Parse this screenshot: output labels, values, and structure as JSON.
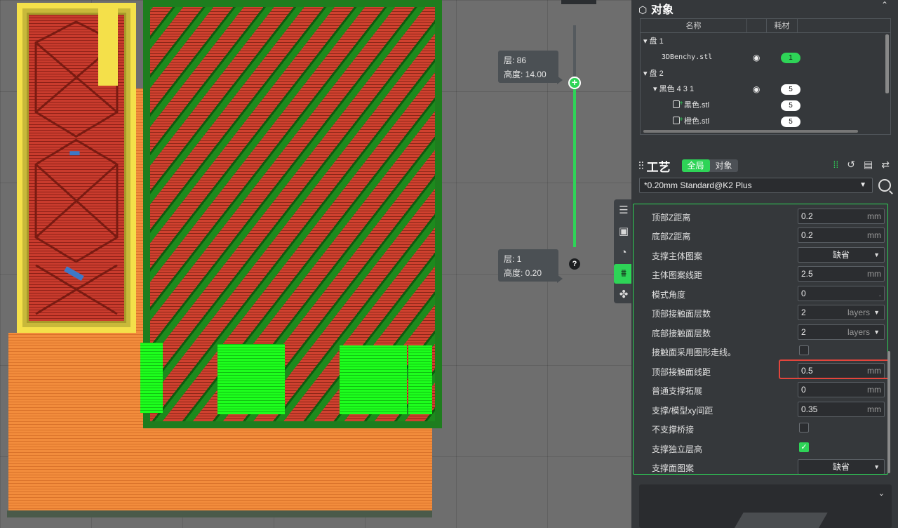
{
  "viewport": {
    "layer_top": {
      "layer_label": "层: 86",
      "height_label": "高度: 14.00"
    },
    "layer_bottom": {
      "layer_label": "层: 1",
      "height_label": "高度: 0.20"
    },
    "slider_help": "?"
  },
  "objects": {
    "title": "对象",
    "columns": {
      "name": "名称",
      "material": "耗材"
    },
    "rows": [
      {
        "name": "▾ 盘 1",
        "indent": 0
      },
      {
        "name": "3DBenchy.stl",
        "visible_icon": "eye-icon",
        "material": "1",
        "material_color": "#2ed457"
      },
      {
        "name": "▾ 盘 2",
        "indent": 0
      },
      {
        "name": "▾ 黑色 4 3 1",
        "visible_icon": "eye-icon",
        "material": "5"
      },
      {
        "name": "黑色.stl",
        "material": "5"
      },
      {
        "name": "橙色.stl",
        "material": "5"
      }
    ]
  },
  "process": {
    "title": "工艺",
    "toggle": {
      "global": "全局",
      "object": "对象"
    },
    "preset": "*0.20mm Standard@K2 Plus",
    "settings": [
      {
        "label": "顶部Z距离",
        "type": "number",
        "value": "0.2",
        "unit": "mm"
      },
      {
        "label": "底部Z距离",
        "type": "number",
        "value": "0.2",
        "unit": "mm"
      },
      {
        "label": "支撑主体图案",
        "type": "select",
        "value": "缺省"
      },
      {
        "label": "主体图案线距",
        "type": "number",
        "value": "2.5",
        "unit": "mm"
      },
      {
        "label": "模式角度",
        "type": "number",
        "value": "0",
        "unit": "."
      },
      {
        "label": "顶部接触面层数",
        "type": "units",
        "value": "2",
        "unit": "layers"
      },
      {
        "label": "底部接触面层数",
        "type": "units",
        "value": "2",
        "unit": "layers"
      },
      {
        "label": "接触面采用圈形走线。",
        "type": "checkbox",
        "checked": false
      },
      {
        "label": "顶部接触面线距",
        "type": "number",
        "value": "0.5",
        "unit": "mm",
        "highlighted": true
      },
      {
        "label": "普通支撑拓展",
        "type": "number",
        "value": "0",
        "unit": "mm"
      },
      {
        "label": "支撑/模型xy间距",
        "type": "number",
        "value": "0.35",
        "unit": "mm"
      },
      {
        "label": "不支撑桥接",
        "type": "checkbox",
        "checked": false
      },
      {
        "label": "支撑独立层高",
        "type": "checkbox",
        "checked": true
      },
      {
        "label": "支撑面图案",
        "type": "select",
        "value": "缺省"
      }
    ]
  },
  "colors": {
    "accent": "#2ed457",
    "highlight": "#e3453c"
  }
}
